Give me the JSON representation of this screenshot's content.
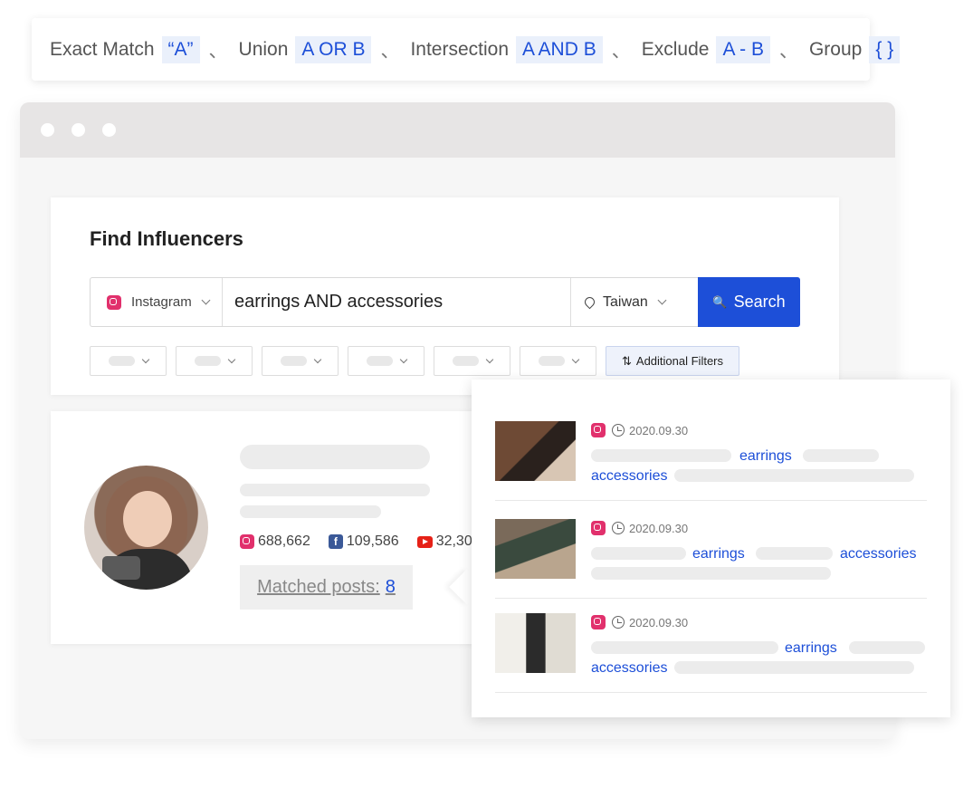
{
  "syntax_legend": {
    "items": [
      {
        "label": "Exact Match",
        "code": "“A”"
      },
      {
        "label": "Union",
        "code": "A OR B"
      },
      {
        "label": "Intersection",
        "code": "A AND B"
      },
      {
        "label": "Exclude",
        "code": "A - B"
      },
      {
        "label": "Group",
        "code": "{ }"
      }
    ],
    "separator": "、"
  },
  "search": {
    "title": "Find Influencers",
    "platform": "Instagram",
    "query": "earrings AND accessories",
    "region": "Taiwan",
    "button_label": "Search",
    "additional_filters_label": "Additional Filters"
  },
  "influencer": {
    "instagram_followers": "688,662",
    "facebook_followers": "109,586",
    "youtube_followers": "32,30",
    "matched_posts_label": "Matched posts:",
    "matched_posts_count": "8"
  },
  "posts": [
    {
      "date": "2020.09.30",
      "kw1": "earrings",
      "kw2": "accessories"
    },
    {
      "date": "2020.09.30",
      "kw1": "earrings",
      "kw2": "accessories"
    },
    {
      "date": "2020.09.30",
      "kw1": "earrings",
      "kw2": "accessories"
    }
  ],
  "colors": {
    "accent": "#1d4fd8",
    "instagram": "#e1306c",
    "facebook": "#3b5998",
    "youtube": "#e62117"
  }
}
